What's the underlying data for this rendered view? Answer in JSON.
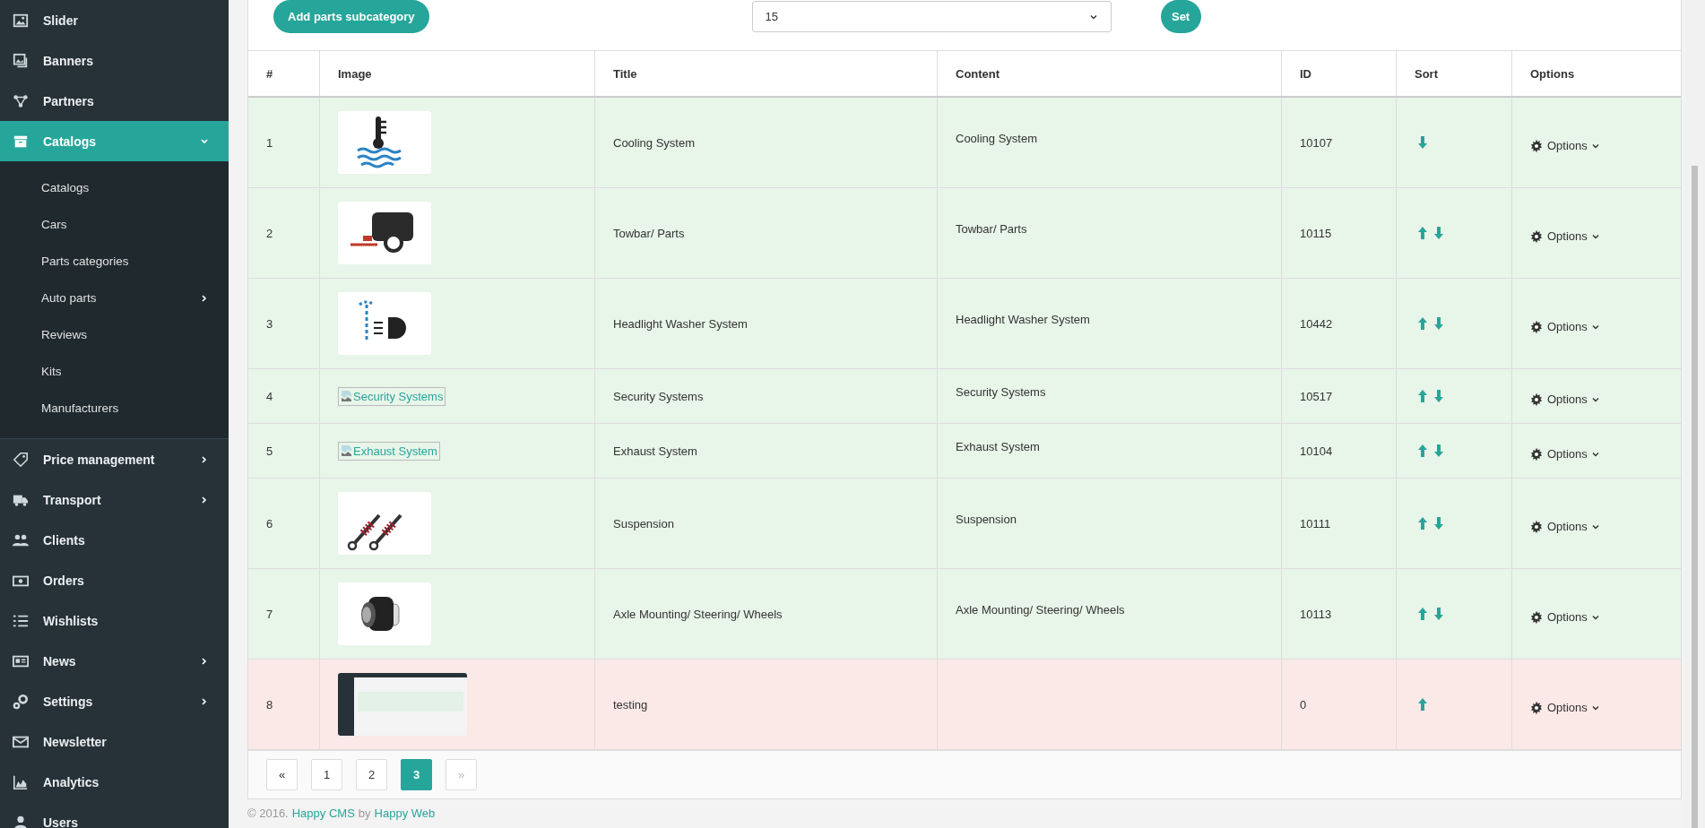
{
  "sidebar": {
    "items": [
      {
        "label": "Slider",
        "has_submenu": false,
        "selected": false
      },
      {
        "label": "Banners",
        "has_submenu": false,
        "selected": false
      },
      {
        "label": "Partners",
        "has_submenu": false,
        "selected": false
      },
      {
        "label": "Catalogs",
        "has_submenu": true,
        "selected": true,
        "expanded": true,
        "children": [
          {
            "label": "Catalogs",
            "has_submenu": false
          },
          {
            "label": "Cars",
            "has_submenu": false
          },
          {
            "label": "Parts categories",
            "has_submenu": false
          },
          {
            "label": "Auto parts",
            "has_submenu": true
          },
          {
            "label": "Reviews",
            "has_submenu": false
          },
          {
            "label": "Kits",
            "has_submenu": false
          },
          {
            "label": "Manufacturers",
            "has_submenu": false
          }
        ]
      },
      {
        "label": "Price management",
        "has_submenu": true,
        "selected": false
      },
      {
        "label": "Transport",
        "has_submenu": true,
        "selected": false
      },
      {
        "label": "Clients",
        "has_submenu": false,
        "selected": false
      },
      {
        "label": "Orders",
        "has_submenu": false,
        "selected": false
      },
      {
        "label": "Wishlists",
        "has_submenu": false,
        "selected": false
      },
      {
        "label": "News",
        "has_submenu": true,
        "selected": false
      },
      {
        "label": "Settings",
        "has_submenu": true,
        "selected": false
      },
      {
        "label": "Newsletter",
        "has_submenu": false,
        "selected": false
      },
      {
        "label": "Analytics",
        "has_submenu": false,
        "selected": false
      },
      {
        "label": "Users",
        "has_submenu": false,
        "selected": false
      }
    ]
  },
  "toolbar": {
    "add_button": "Add parts subcategory",
    "per_page_select": "15",
    "set_button": "Set"
  },
  "table": {
    "columns": [
      "#",
      "Image",
      "Title",
      "Content",
      "ID",
      "Sort",
      "Options"
    ],
    "rows": [
      {
        "number": "1",
        "image": {
          "kind": "coolant"
        },
        "title": "Cooling System",
        "content": "Cooling System",
        "id": "10107",
        "move_up": false,
        "move_down": true,
        "options": "Options",
        "inactive": false
      },
      {
        "number": "2",
        "image": {
          "kind": "trailer"
        },
        "title": "Towbar/ Parts",
        "content": "Towbar/ Parts",
        "id": "10115",
        "move_up": true,
        "move_down": true,
        "options": "Options",
        "inactive": false
      },
      {
        "number": "3",
        "image": {
          "kind": "washer"
        },
        "title": "Headlight Washer System",
        "content": "Headlight Washer System",
        "id": "10442",
        "move_up": true,
        "move_down": true,
        "options": "Options",
        "inactive": false
      },
      {
        "number": "4",
        "image": {
          "kind": "broken",
          "alt": "Security Systems"
        },
        "title": "Security Systems",
        "content": "Security Systems",
        "id": "10517",
        "move_up": true,
        "move_down": true,
        "options": "Options",
        "inactive": false
      },
      {
        "number": "5",
        "image": {
          "kind": "broken",
          "alt": "Exhaust System"
        },
        "title": "Exhaust System",
        "content": "Exhaust System",
        "id": "10104",
        "move_up": true,
        "move_down": true,
        "options": "Options",
        "inactive": false
      },
      {
        "number": "6",
        "image": {
          "kind": "shocks"
        },
        "title": "Suspension",
        "content": "Suspension",
        "id": "10111",
        "move_up": true,
        "move_down": true,
        "options": "Options",
        "inactive": false
      },
      {
        "number": "7",
        "image": {
          "kind": "bushing"
        },
        "title": "Axle Mounting/ Steering/ Wheels",
        "content": "Axle Mounting/ Steering/ Wheels",
        "id": "10113",
        "move_up": true,
        "move_down": true,
        "options": "Options",
        "inactive": false
      },
      {
        "number": "8",
        "image": {
          "kind": "screenshot"
        },
        "title": "testing",
        "id": "0",
        "move_up": true,
        "move_down": false,
        "options": "Options",
        "inactive": true
      }
    ]
  },
  "pagination": [
    {
      "label": "«",
      "selected": false,
      "disabled": false
    },
    {
      "label": "1",
      "selected": false,
      "disabled": false
    },
    {
      "label": "2",
      "selected": false,
      "disabled": false
    },
    {
      "label": "3",
      "selected": true,
      "disabled": false
    },
    {
      "label": "»",
      "selected": false,
      "disabled": true
    }
  ],
  "footer": {
    "text": "© 2016.",
    "product_link": "Happy CMS",
    "by": "by",
    "company_link": "Happy Web"
  }
}
